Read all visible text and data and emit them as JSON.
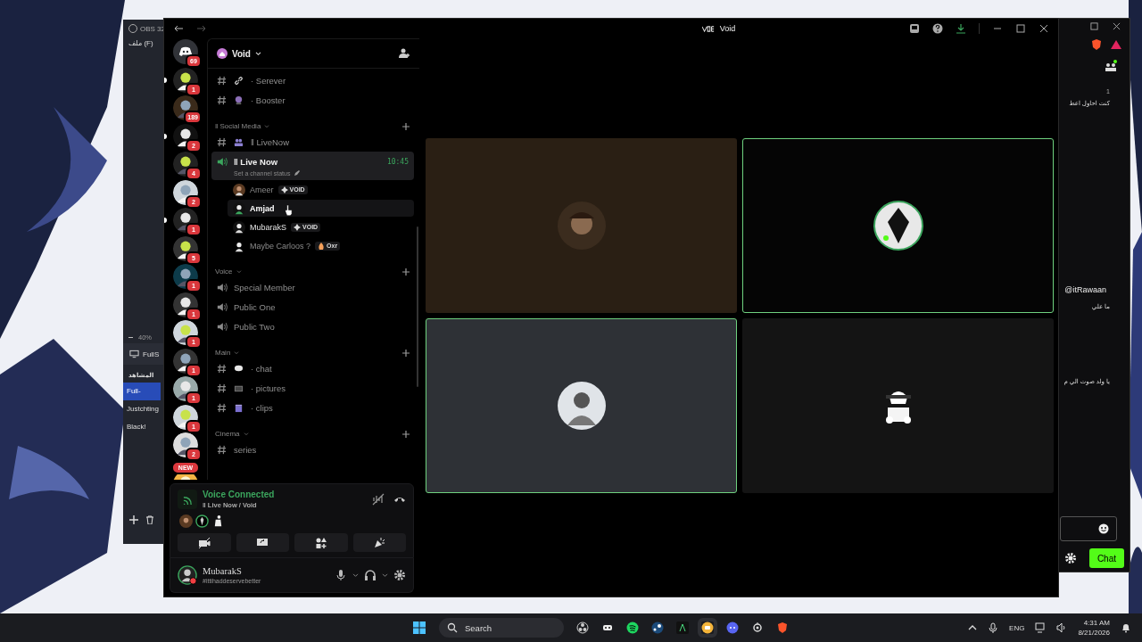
{
  "obs": {
    "title": "OBS 32",
    "menu": "ملف (F)",
    "zoom": "40%",
    "source": "FullS",
    "scenes_title": "المشاهد",
    "scenes": [
      {
        "name": "Full-",
        "selected": true
      },
      {
        "name": "Justchting",
        "selected": false
      },
      {
        "name": "Black!",
        "selected": false
      }
    ]
  },
  "browser": {
    "messages": [
      {
        "kind": "meta",
        "text": "1"
      },
      {
        "kind": "text",
        "text": "كنت احاول اعط"
      },
      {
        "kind": "author",
        "text": "@itRawaan"
      },
      {
        "kind": "text",
        "text": "ما علي"
      },
      {
        "kind": "text",
        "text": "يا ولد صوت الي م"
      }
    ],
    "chat_button": "Chat"
  },
  "discord": {
    "title": "Void",
    "server_name": "Void",
    "servers": [
      {
        "badge": "69",
        "unread": false
      },
      {
        "badge": "1",
        "unread": true
      },
      {
        "badge": "189",
        "unread": false
      },
      {
        "badge": "2",
        "unread": true
      },
      {
        "badge": "4",
        "unread": false
      },
      {
        "badge": "2",
        "unread": false
      },
      {
        "badge": "1",
        "unread": true
      },
      {
        "badge": "5",
        "unread": false
      },
      {
        "badge": "1",
        "unread": false
      },
      {
        "badge": "1",
        "unread": false
      },
      {
        "badge": "1",
        "unread": false
      },
      {
        "badge": "1",
        "unread": false
      },
      {
        "badge": "1",
        "unread": false
      },
      {
        "badge": "1",
        "unread": false
      },
      {
        "badge": "2",
        "unread": false
      }
    ],
    "new_badge": "NEW",
    "sections": [
      {
        "channels": [
          {
            "kind": "text",
            "name": "· Serever"
          },
          {
            "kind": "text",
            "name": "· Booster"
          }
        ]
      },
      {
        "name": "‖ Social Media",
        "channels": [
          {
            "kind": "text",
            "name": "‖ LiveNow"
          },
          {
            "kind": "voice",
            "name": "‖ Live Now",
            "selected": true,
            "time": "10:45",
            "status": "Set a channel status",
            "members": [
              {
                "name": "Ameer",
                "tag": "VOID",
                "dimmed": true,
                "hovered": false
              },
              {
                "name": "Amjad",
                "dimmed": false,
                "hovered": true
              },
              {
                "name": "MubarakS",
                "tag": "VOID",
                "dimmed": false,
                "hovered": false
              },
              {
                "name": "Maybe Carloos ?",
                "tag": "Oxr",
                "dimmed": true,
                "hovered": false
              }
            ]
          }
        ]
      },
      {
        "name": "Voice",
        "channels": [
          {
            "kind": "voice",
            "name": "Special Member",
            "selected": false
          },
          {
            "kind": "voice",
            "name": "Public One",
            "selected": false
          },
          {
            "kind": "voice",
            "name": "Public Two",
            "selected": false
          }
        ]
      },
      {
        "name": "Main",
        "channels": [
          {
            "kind": "text",
            "name": "· chat"
          },
          {
            "kind": "text",
            "name": "· pictures"
          },
          {
            "kind": "text",
            "name": "· clips"
          }
        ]
      },
      {
        "name": "Cinema",
        "channels": [
          {
            "kind": "text",
            "name": "series"
          }
        ]
      }
    ],
    "voice_panel": {
      "title": "Voice Connected",
      "channel": "‖ Live Now / Void"
    },
    "user": {
      "name": "MubarakS",
      "status": "#ittihaddeservebetter"
    },
    "tiles": [
      {
        "color": "#2a1f14",
        "speaking": false
      },
      {
        "color": "#050505",
        "speaking": true
      },
      {
        "color": "#2e3136",
        "speaking": true
      },
      {
        "color": "#141414",
        "speaking": false
      }
    ]
  },
  "taskbar": {
    "search": "Search",
    "language": "ENG",
    "time": "4:31 AM",
    "date": "8/21/2026"
  }
}
